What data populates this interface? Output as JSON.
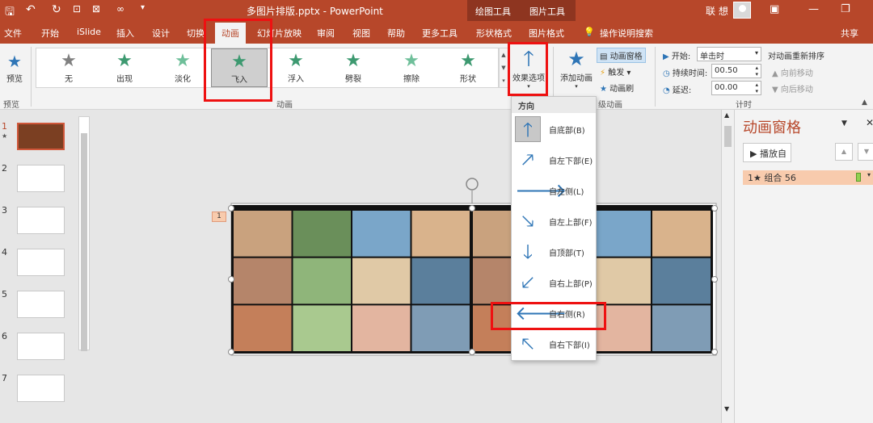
{
  "window": {
    "doc_title": "多图片排版.pptx - PowerPoint",
    "ctx_drawing": "绘图工具",
    "ctx_picture": "图片工具",
    "user": "联 想",
    "share": "共享",
    "qa_save": "🖫",
    "qa_undo": "↶",
    "qa_redo": "↻",
    "qa_more": "▾",
    "min": "—",
    "restore": "❐",
    "ribbon_toggle": "▣"
  },
  "tabs": [
    "文件",
    "开始",
    "iSlide",
    "插入",
    "设计",
    "切换",
    "动画",
    "幻灯片放映",
    "审阅",
    "视图",
    "帮助",
    "更多工具",
    "形状格式",
    "图片格式",
    "操作说明搜索"
  ],
  "ribbon": {
    "preview_label": "预览",
    "preview_group": "预览",
    "animation_group": "动画",
    "advanced_group": "级动画",
    "timing_group": "计时",
    "gallery": [
      {
        "label": "无",
        "color": "#808080"
      },
      {
        "label": "出现",
        "color": "#3d9970"
      },
      {
        "label": "淡化",
        "color": "#6fbf9a"
      },
      {
        "label": "飞入",
        "color": "#3d9970"
      },
      {
        "label": "浮入",
        "color": "#3d9970"
      },
      {
        "label": "劈裂",
        "color": "#3d9970"
      },
      {
        "label": "擦除",
        "color": "#6fbf9a"
      },
      {
        "label": "形状",
        "color": "#3d9970"
      }
    ],
    "effect_options": "效果选项",
    "add_animation": "添加动画",
    "anim_pane_btn": "动画窗格",
    "trigger": "触发",
    "anim_painter": "动画刷",
    "start_label": "开始:",
    "start_value": "单击时",
    "duration_label": "持续时间:",
    "duration_value": "00.50",
    "delay_label": "延迟:",
    "delay_value": "00.00",
    "reorder_title": "对动画重新排序",
    "move_earlier": "向前移动",
    "move_later": "向后移动"
  },
  "dropdown": {
    "header": "方向",
    "items": [
      {
        "label": "自底部(B)",
        "arrow": "🡑"
      },
      {
        "label": "自左下部(E)",
        "arrow": "🡕"
      },
      {
        "label": "自左侧(L)",
        "arrow": "🡒"
      },
      {
        "label": "自左上部(F)",
        "arrow": "🡖"
      },
      {
        "label": "自顶部(T)",
        "arrow": "🡓"
      },
      {
        "label": "自右上部(P)",
        "arrow": "🡗"
      },
      {
        "label": "自右侧(R)",
        "arrow": "🡐"
      },
      {
        "label": "自右下部(I)",
        "arrow": "🡔"
      }
    ]
  },
  "slides": [
    "1",
    "2",
    "3",
    "4",
    "5",
    "6",
    "7"
  ],
  "slide_star": "★",
  "canvas": {
    "tag": "1"
  },
  "pane": {
    "title": "动画窗格",
    "play_from": "播放自",
    "item": "1★ 组合 56"
  },
  "colors": {
    "accent": "#b7472a",
    "highlight": "#e11",
    "arrow": "#2e75b6"
  }
}
